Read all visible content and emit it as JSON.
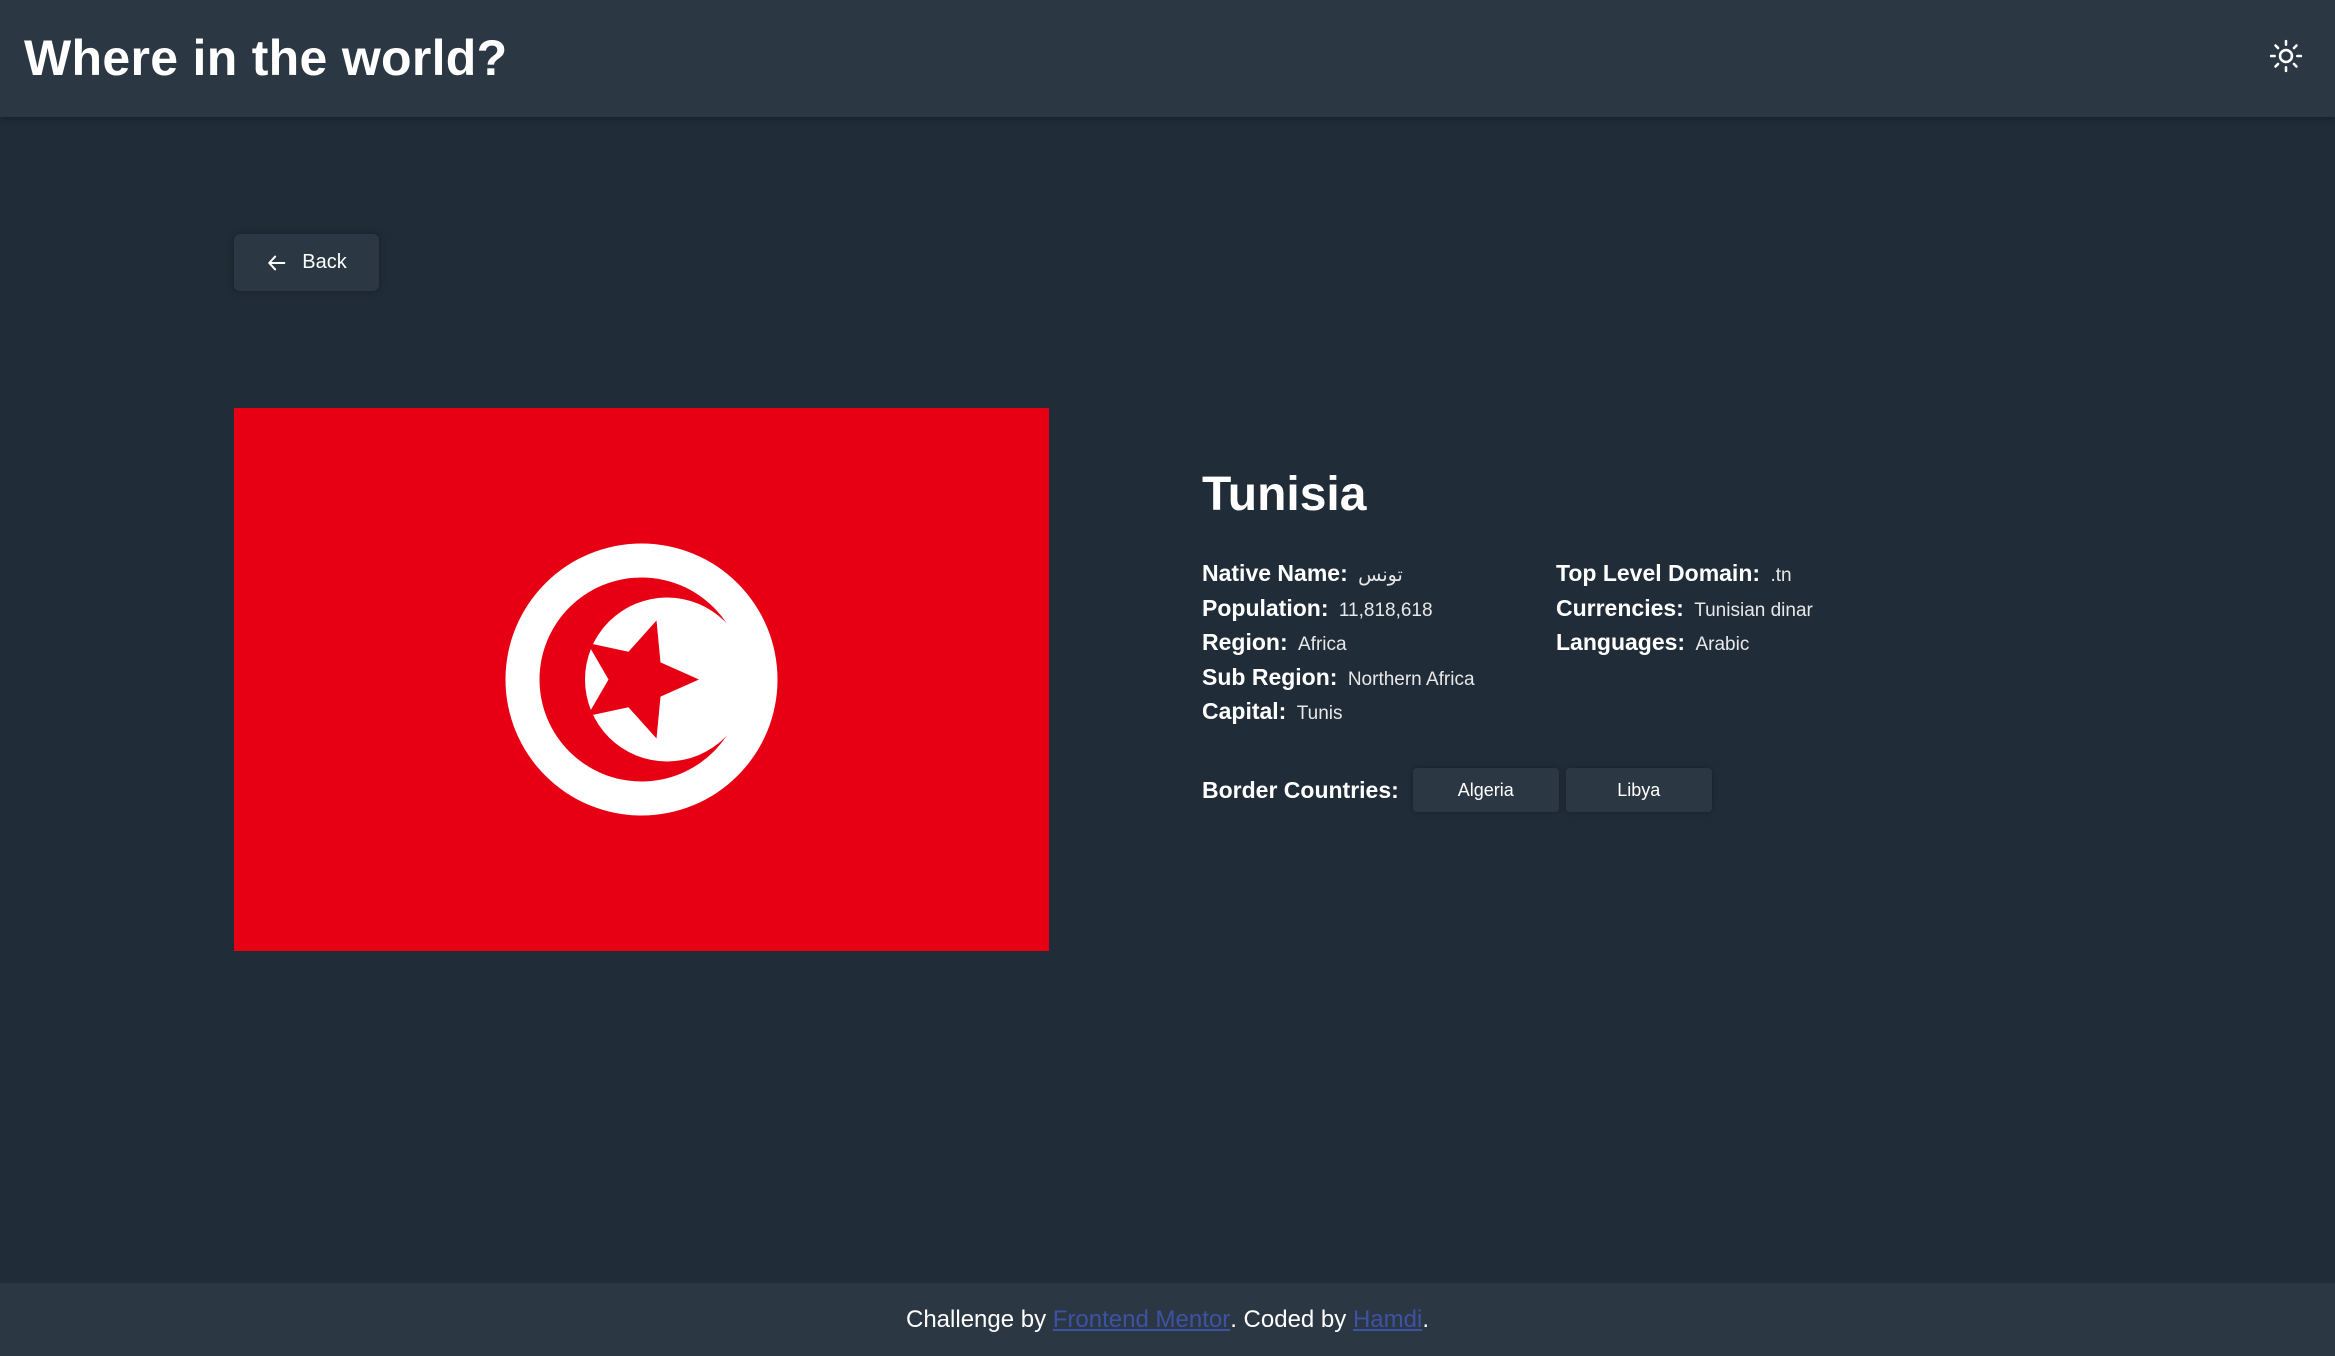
{
  "header": {
    "title": "Where in the world?",
    "theme_icon": "sun-icon"
  },
  "back_button": {
    "label": "Back",
    "icon": "arrow-left-icon"
  },
  "flag": {
    "colors": {
      "field": "#e70013",
      "emblem": "#ffffff"
    },
    "icon": "tunisia-flag"
  },
  "country": {
    "name": "Tunisia",
    "left_column": [
      {
        "label": "Native Name:",
        "value": "تونس"
      },
      {
        "label": "Population:",
        "value": "11,818,618"
      },
      {
        "label": "Region:",
        "value": "Africa"
      },
      {
        "label": "Sub Region:",
        "value": "Northern Africa"
      },
      {
        "label": "Capital:",
        "value": "Tunis"
      }
    ],
    "right_column": [
      {
        "label": "Top Level Domain:",
        "value": ".tn"
      },
      {
        "label": "Currencies:",
        "value": "Tunisian dinar"
      },
      {
        "label": "Languages:",
        "value": "Arabic"
      }
    ],
    "borders_label": "Border Countries:",
    "borders": [
      "Algeria",
      "Libya"
    ]
  },
  "footer": {
    "prefix": "Challenge by ",
    "link1": "Frontend Mentor",
    "middle": ". Coded by ",
    "link2": "Hamdi",
    "suffix": "."
  },
  "colors": {
    "background": "#202c37",
    "surface": "#2b3743",
    "link": "#3e52a3"
  }
}
